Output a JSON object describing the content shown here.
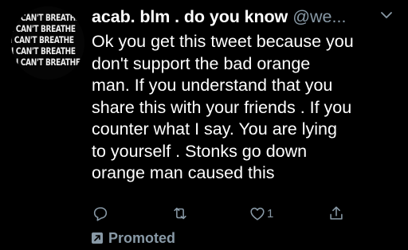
{
  "author": {
    "avatar_lines": [
      "I CAN'T BREATHE",
      "I CAN'T BREATHE",
      "I CAN'T BREATHE",
      "I CAN'T BREATHE",
      "I CAN'T BREATHE"
    ],
    "display_name": "acab. blm . do you know",
    "handle": "@we..."
  },
  "tweet": {
    "lines": [
      "Ok you get this tweet because you",
      "don't support the bad orange",
      "man. If you understand that you",
      "share this with your friends . If you",
      "counter what I say. You are lying",
      "to yourself . Stonks go down",
      "orange man caused this"
    ]
  },
  "actions": {
    "like_count": "1",
    "icons": [
      "reply-icon",
      "retweet-icon",
      "like-icon",
      "share-icon"
    ]
  },
  "promoted": {
    "label": "Promoted",
    "icon": "promoted-arrow-icon"
  },
  "colors": {
    "background": "#000000",
    "text": "#ffffff",
    "secondary": "#8899a6"
  }
}
